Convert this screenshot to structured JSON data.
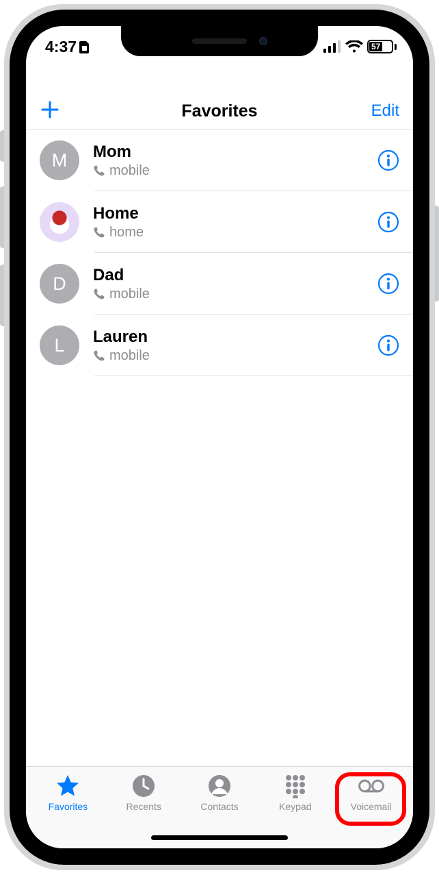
{
  "status": {
    "time": "4:37",
    "battery_pct": "57"
  },
  "nav": {
    "title": "Favorites",
    "edit": "Edit"
  },
  "favorites": [
    {
      "name": "Mom",
      "type": "mobile",
      "avatar_letter": "M",
      "avatar_kind": "letter"
    },
    {
      "name": "Home",
      "type": "home",
      "avatar_letter": "",
      "avatar_kind": "image"
    },
    {
      "name": "Dad",
      "type": "mobile",
      "avatar_letter": "D",
      "avatar_kind": "letter"
    },
    {
      "name": "Lauren",
      "type": "mobile",
      "avatar_letter": "L",
      "avatar_kind": "letter"
    }
  ],
  "tabs": {
    "favorites": "Favorites",
    "recents": "Recents",
    "contacts": "Contacts",
    "keypad": "Keypad",
    "voicemail": "Voicemail"
  },
  "highlight_tab": "voicemail"
}
